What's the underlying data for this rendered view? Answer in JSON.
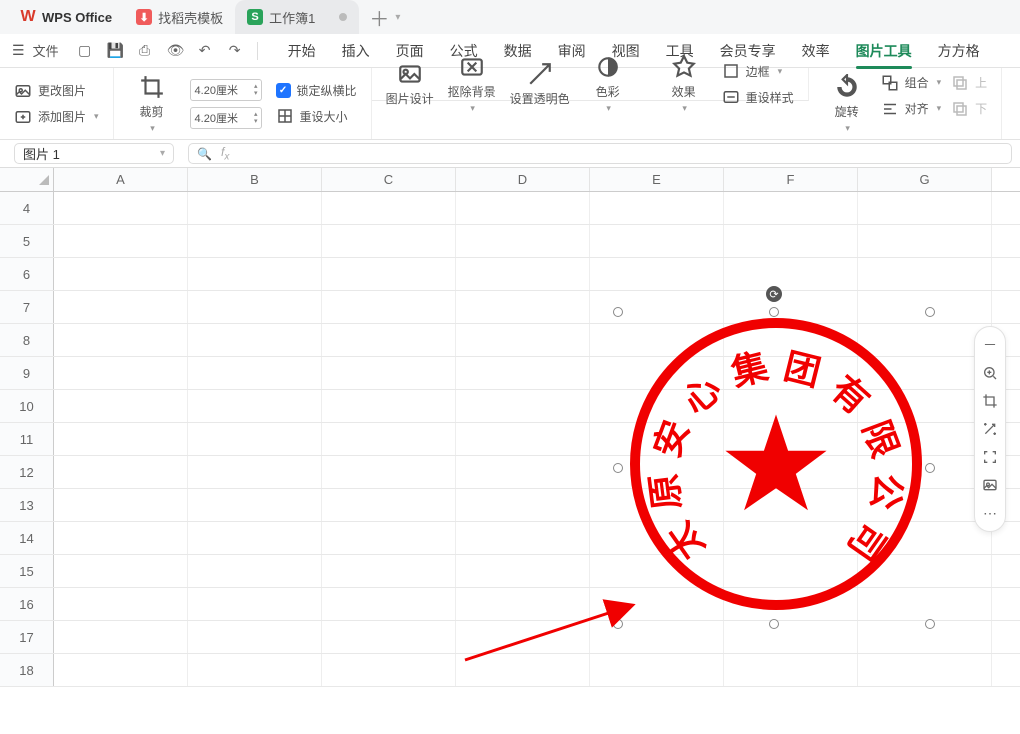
{
  "tabs": {
    "app": "WPS Office",
    "template": "找稻壳模板",
    "doc": "工作簿1"
  },
  "file_menu": "文件",
  "menus": [
    "开始",
    "插入",
    "页面",
    "公式",
    "数据",
    "审阅",
    "视图",
    "工具",
    "会员专享",
    "效率",
    "图片工具",
    "方方格"
  ],
  "active_menu": 10,
  "ribbon": {
    "change_pic": "更改图片",
    "add_pic": "添加图片",
    "crop": "裁剪",
    "width": "4.20厘米",
    "height": "4.20厘米",
    "lock_ratio": "锁定纵横比",
    "reset_size": "重设大小",
    "pic_design": "图片设计",
    "remove_bg": "抠除背景",
    "set_transparent": "设置透明色",
    "color": "色彩",
    "effect": "效果",
    "border": "边框",
    "reset_style": "重设样式",
    "rotate": "旋转",
    "group": "组合",
    "align": "对齐",
    "up": "上",
    "down": "下"
  },
  "namebox": "图片 1",
  "columns": [
    "A",
    "B",
    "C",
    "D",
    "E",
    "F",
    "G"
  ],
  "rows": [
    4,
    5,
    6,
    7,
    8,
    9,
    10,
    11,
    12,
    13,
    14,
    15,
    16,
    17,
    18
  ],
  "stamp_text": "太原安心集团有限公司",
  "float_tools": [
    "minus",
    "zoom-in",
    "crop",
    "magic",
    "focus",
    "filter",
    "more"
  ]
}
